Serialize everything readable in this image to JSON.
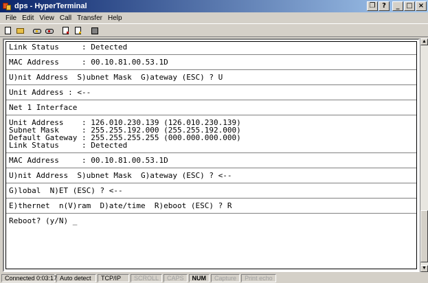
{
  "window": {
    "title": "dps - HyperTerminal"
  },
  "menu": [
    "File",
    "Edit",
    "View",
    "Call",
    "Transfer",
    "Help"
  ],
  "toolbar": [
    {
      "icon": "new-connection-icon"
    },
    {
      "icon": "open-icon"
    },
    {
      "icon": "call-icon"
    },
    {
      "icon": "disconnect-icon"
    },
    {
      "icon": "send-icon"
    },
    {
      "icon": "receive-icon"
    },
    {
      "icon": "properties-icon"
    }
  ],
  "terminal": {
    "lines": [
      "Link Status     : Detected",
      "---",
      "MAC Address     : 00.10.81.00.53.1D",
      "---",
      "U)nit Address  S)ubnet Mask  G)ateway (ESC) ? U",
      "---",
      "Unit Address : <--",
      "---",
      "Net 1 Interface",
      "---",
      "Unit Address    : 126.010.230.139 (126.010.230.139)",
      "Subnet Mask     : 255.255.192.000 (255.255.192.000)",
      "Default Gateway : 255.255.255.255 (000.000.000.000)",
      "Link Status     : Detected",
      "---",
      "MAC Address     : 00.10.81.00.53.1D",
      "---",
      "U)nit Address  S)ubnet Mask  G)ateway (ESC) ? <--",
      "---",
      "G)lobal  N)ET (ESC) ? <--",
      "---",
      "E)thernet  n(V)ram  D)ate/time  R)eboot (ESC) ? R",
      "---",
      "Reboot? (y/N) _"
    ]
  },
  "status": {
    "connected": "Connected 0:03:17",
    "detect": "Auto detect",
    "protocol": "TCP/IP",
    "scroll": "SCROLL",
    "caps": "CAPS",
    "num": "NUM",
    "capture": "Capture",
    "print_echo": "Print echo"
  }
}
